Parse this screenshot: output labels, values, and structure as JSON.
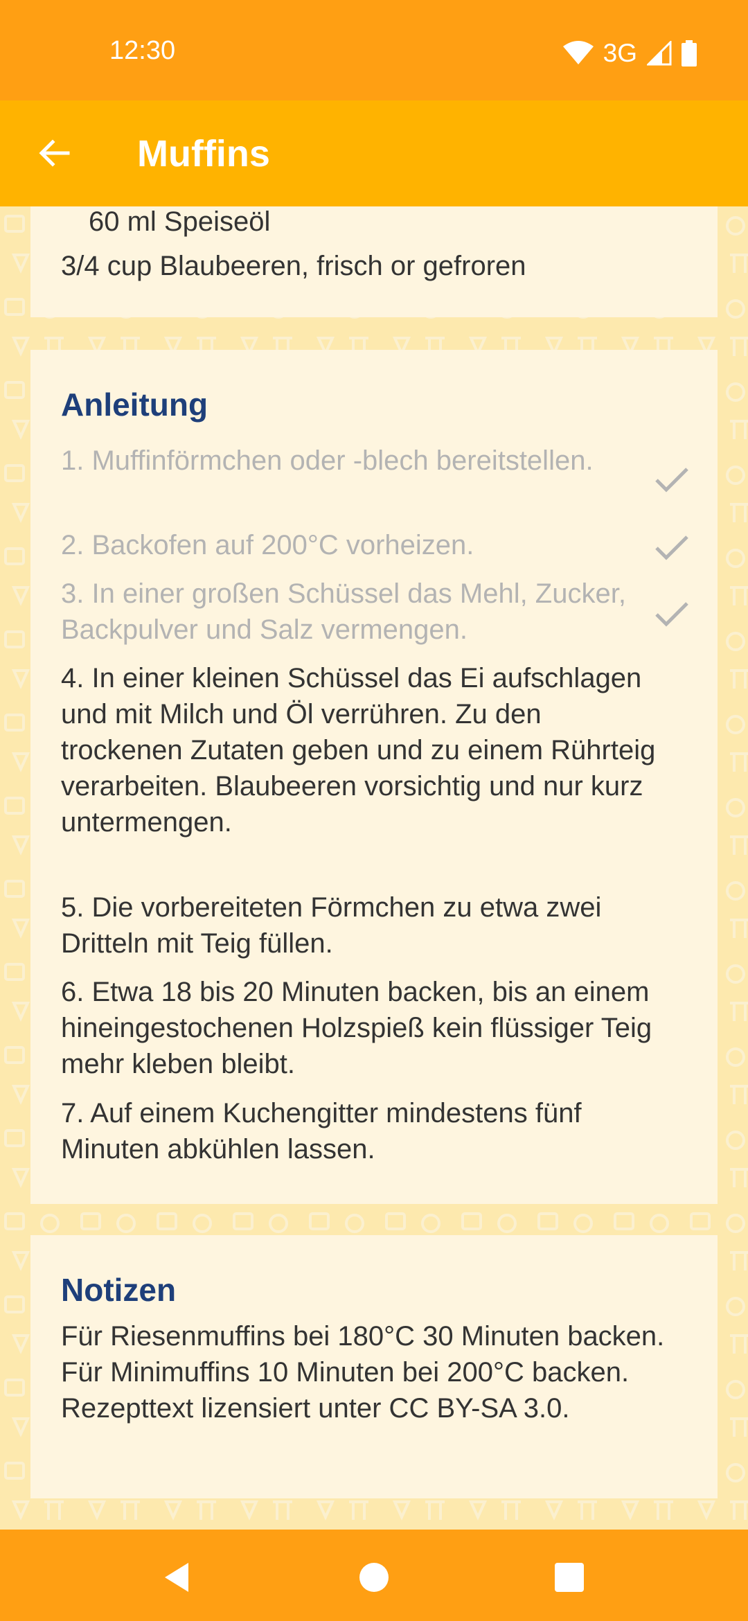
{
  "status_bar": {
    "time": "12:30",
    "network": "3G",
    "icons": [
      "wifi-icon",
      "signal-icon",
      "battery-icon"
    ]
  },
  "app_bar": {
    "title": "Muffins",
    "back_icon": "arrow-left-icon"
  },
  "ingredients": {
    "lines": [
      "60 ml Speiseöl",
      "3/4 cup Blaubeeren, frisch or gefroren"
    ]
  },
  "instructions": {
    "title": "Anleitung",
    "steps": [
      {
        "text": "1. Muffinförmchen oder -blech bereitstellen.",
        "done": true
      },
      {
        "text": "2. Backofen auf 200°C vorheizen.",
        "done": true
      },
      {
        "text": "3. In einer großen Schüssel das Mehl, Zucker, Backpulver und Salz vermengen.",
        "done": true
      },
      {
        "text": "4. In einer kleinen Schüssel das Ei aufschlagen und mit Milch und Öl verrühren. Zu den trockenen Zutaten geben und zu einem Rührteig verarbeiten. Blaubeeren vorsichtig und nur kurz untermengen.",
        "done": false
      },
      {
        "text": "5. Die vorbereiteten Förmchen zu etwa zwei Dritteln mit Teig füllen.",
        "done": false
      },
      {
        "text": "6. Etwa 18 bis 20 Minuten backen, bis an einem hineingestochenen Holzspieß kein flüssiger Teig mehr kleben bleibt.",
        "done": false
      },
      {
        "text": "7. Auf einem Kuchengitter mindestens fünf Minuten abkühlen lassen.",
        "done": false
      }
    ]
  },
  "notes": {
    "title": "Notizen",
    "text": "Für Riesenmuffins bei 180°C 30 Minuten backen. Für Minimuffins 10 Minuten bei 200°C backen. Rezepttext lizensiert unter CC BY-SA 3.0."
  },
  "nav_bar": {
    "icons": [
      "back-triangle-icon",
      "home-circle-icon",
      "recents-square-icon"
    ]
  },
  "colors": {
    "status_bar": "#FF9F13",
    "app_bar": "#FFB300",
    "background": "#FDE9AE",
    "card": "#FEF5DF",
    "section_title": "#1E3F7A",
    "done_text": "#B3B3B3"
  }
}
